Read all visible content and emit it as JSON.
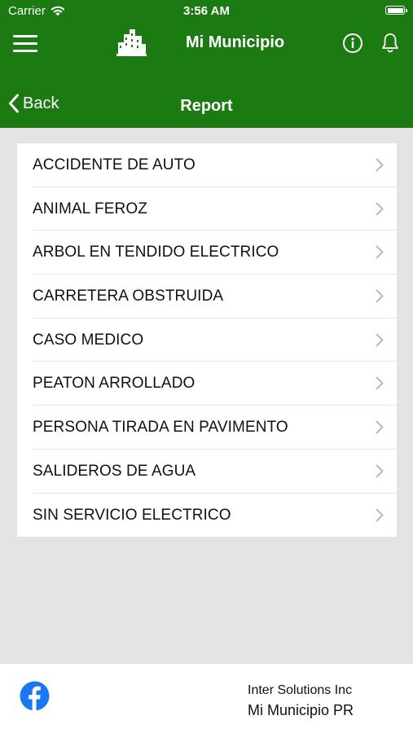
{
  "status_bar": {
    "carrier": "Carrier",
    "time": "3:56 AM"
  },
  "header": {
    "app_title": "Mi Municipio"
  },
  "nav": {
    "back_label": "Back",
    "title": "Report"
  },
  "report_types": [
    {
      "label": "ACCIDENTE DE AUTO"
    },
    {
      "label": "ANIMAL FEROZ"
    },
    {
      "label": "ARBOL EN TENDIDO ELECTRICO"
    },
    {
      "label": "CARRETERA OBSTRUIDA"
    },
    {
      "label": "CASO MEDICO"
    },
    {
      "label": "PEATON ARROLLADO"
    },
    {
      "label": "PERSONA TIRADA EN PAVIMENTO"
    },
    {
      "label": "SALIDEROS DE AGUA"
    },
    {
      "label": "SIN SERVICIO ELECTRICO"
    }
  ],
  "footer": {
    "company": "Inter Solutions Inc",
    "app_name": "Mi Municipio PR"
  },
  "colors": {
    "brand_green": "#1b7a12",
    "background": "#e4e4e4",
    "facebook_blue": "#1877f2"
  },
  "icons": {
    "menu": "hamburger-menu-icon",
    "logo": "city-buildings-icon",
    "info": "info-circle-icon",
    "notifications": "bell-icon",
    "back": "chevron-left-icon",
    "row": "chevron-right-icon",
    "social": "facebook-icon"
  }
}
